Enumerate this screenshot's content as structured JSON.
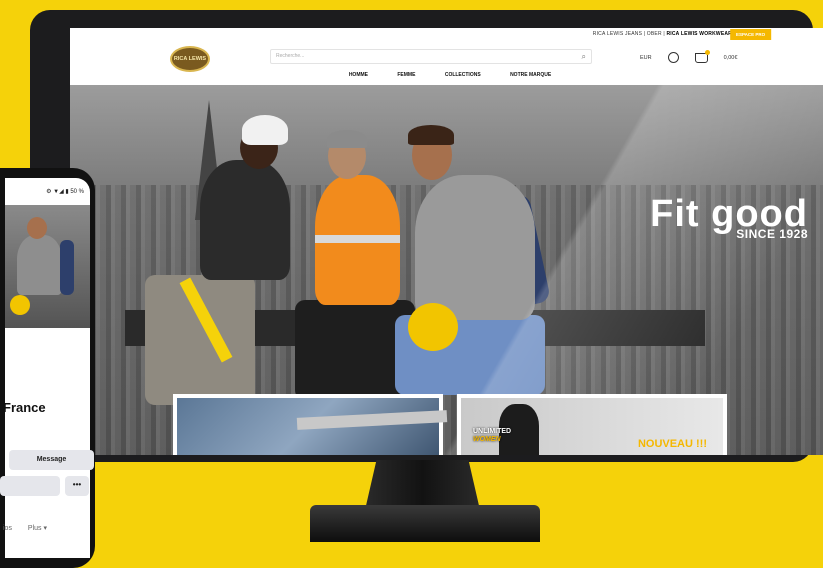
{
  "topbar": {
    "brands_prefix": "RICA LEWIS JEANS | OBER | ",
    "brands_bold": "RICA LEWIS WORKWEAR",
    "pro_button": "ESPACE PRO"
  },
  "header": {
    "logo_text": "RICA LEWIS",
    "search_placeholder": "Recherche...",
    "lang": "EUR",
    "cart": "0,00€"
  },
  "nav": [
    "HOMME",
    "FEMME",
    "COLLECTIONS",
    "NOTRE MARQUE"
  ],
  "hero": {
    "headline": "Fit good",
    "subline": "SINCE 1928"
  },
  "cards": {
    "card2_label_1": "UNLIMITED",
    "card2_label_2": "WOMEN",
    "card2_badge": "NOUVEAU !!!"
  },
  "phone": {
    "status": "⚙ ▼◢ ▮ 50 %",
    "page_name": "France",
    "message_button": "Message",
    "more_button": "•••",
    "tab_photos": "ios",
    "tab_more": "Plus ▾"
  },
  "colors": {
    "background": "#f5d20a",
    "accent": "#f5b800"
  }
}
